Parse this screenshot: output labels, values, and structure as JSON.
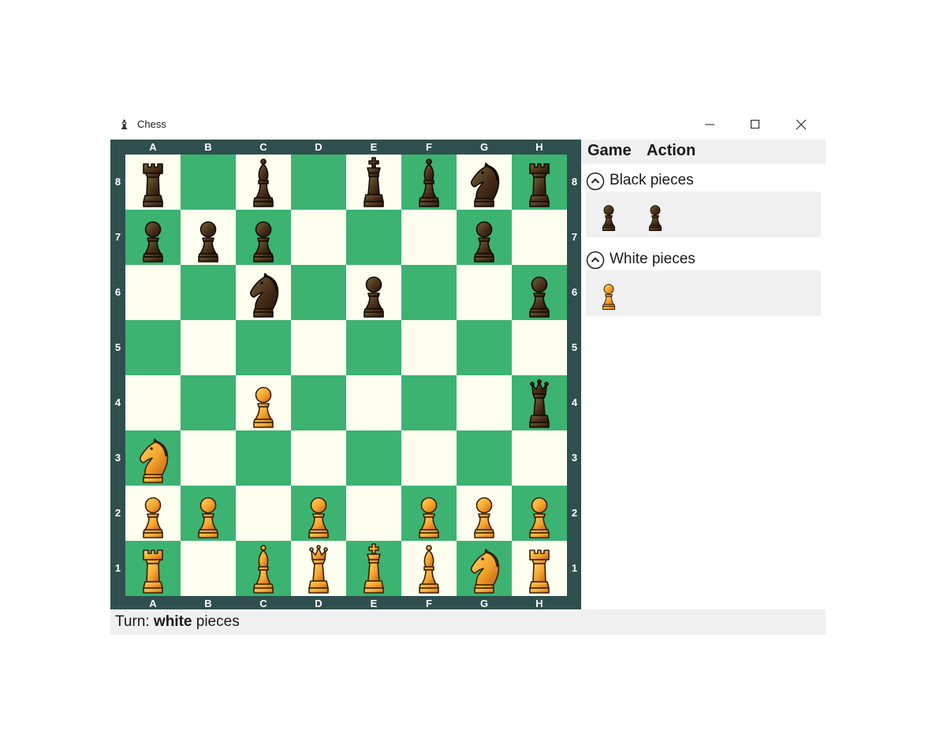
{
  "window": {
    "title": "Chess",
    "app_icon": "chess-pieces-icon"
  },
  "board": {
    "files": [
      "A",
      "B",
      "C",
      "D",
      "E",
      "F",
      "G",
      "H"
    ],
    "ranks": [
      "8",
      "7",
      "6",
      "5",
      "4",
      "3",
      "2",
      "1"
    ],
    "light_color": "#fffff0",
    "dark_color": "#3cb371",
    "frame_color": "#2f4f4f",
    "rows": [
      [
        "br",
        "",
        "bb",
        "",
        "bk",
        "bb",
        "bn",
        "br"
      ],
      [
        "bp",
        "bp",
        "bp",
        "",
        "",
        "",
        "bp",
        ""
      ],
      [
        "",
        "",
        "bn",
        "",
        "bp",
        "",
        "",
        "bp"
      ],
      [
        "",
        "",
        "",
        "",
        "",
        "",
        "",
        ""
      ],
      [
        "",
        "",
        "wp",
        "",
        "",
        "",
        "",
        "bq"
      ],
      [
        "wn",
        "",
        "",
        "",
        "",
        "",
        "",
        ""
      ],
      [
        "wp",
        "wp",
        "",
        "wp",
        "",
        "wp",
        "wp",
        "wp"
      ],
      [
        "wr",
        "",
        "wb",
        "wq",
        "wk",
        "wb",
        "wn",
        "wr"
      ]
    ]
  },
  "menu": {
    "game": "Game",
    "action": "Action"
  },
  "captured": {
    "black": {
      "title": "Black pieces",
      "pieces": [
        "bp",
        "bp"
      ]
    },
    "white": {
      "title": "White pieces",
      "pieces": [
        "wp"
      ]
    }
  },
  "status": {
    "prefix": "Turn:",
    "color": "white",
    "suffix": "pieces"
  }
}
